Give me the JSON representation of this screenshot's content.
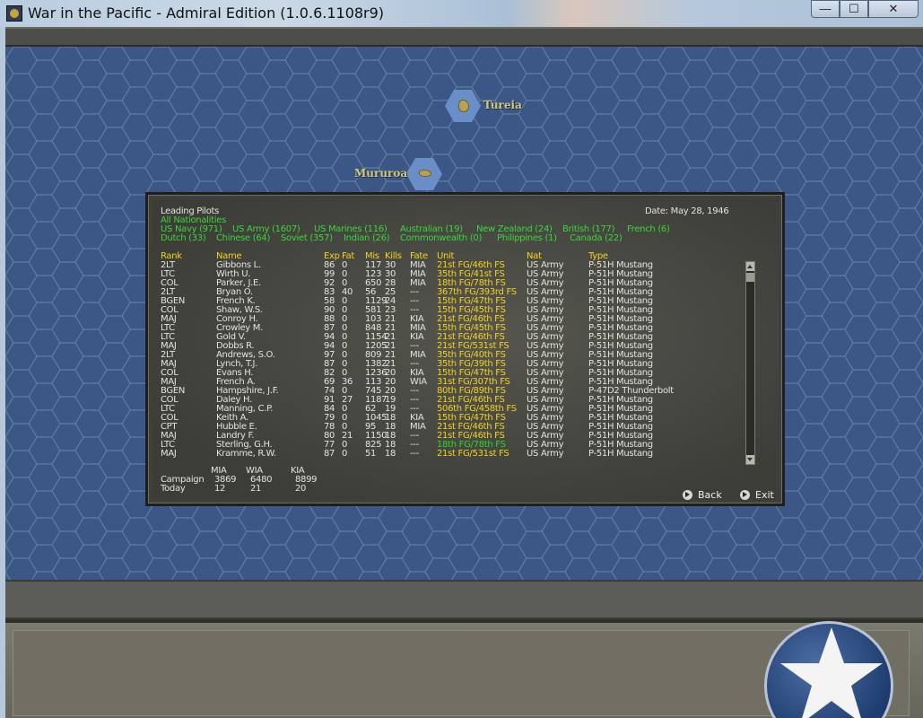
{
  "window": {
    "title": "War in the Pacific - Admiral Edition (1.0.6.1108r9)",
    "minimize_glyph": "—",
    "maximize_glyph": "☐",
    "close_glyph": "✕"
  },
  "map": {
    "places": [
      {
        "name": "Tureia"
      },
      {
        "name": "Mururoa"
      }
    ]
  },
  "dialog": {
    "title": "Leading Pilots",
    "date": "Date: May 28, 1946",
    "all_nationalities": "All Nationalities",
    "filters_row1": [
      "US Navy (971)",
      "US Army (1607)",
      "US Marines (116)",
      "Australian (19)",
      "New Zealand (24)",
      "British (177)",
      "French (6)"
    ],
    "filters_row2": [
      "Dutch (33)",
      "Chinese (64)",
      "Soviet (357)",
      "Indian (26)",
      "Commonwealth (0)",
      "Philippines (1)",
      "Canada (22)"
    ],
    "columns": {
      "rank": "Rank",
      "name": "Name",
      "exp": "Exp",
      "fat": "Fat",
      "mis": "Mis",
      "kills": "Kills",
      "fate": "Fate",
      "unit": "Unit",
      "nat": "Nat",
      "type": "Type"
    },
    "pilots": [
      {
        "rank": "2LT",
        "name": "Gibbons L.",
        "exp": "86",
        "fat": "0",
        "mis": "117",
        "kills": "30",
        "fate": "MIA",
        "unit": "21st FG/46th FS",
        "nat": "US Army",
        "type": "P-51H Mustang"
      },
      {
        "rank": "LTC",
        "name": "Wirth U.",
        "exp": "99",
        "fat": "0",
        "mis": "123",
        "kills": "30",
        "fate": "MIA",
        "unit": "35th FG/41st FS",
        "nat": "US Army",
        "type": "P-51H Mustang"
      },
      {
        "rank": "COL",
        "name": "Parker, J.E.",
        "exp": "92",
        "fat": "0",
        "mis": "650",
        "kills": "28",
        "fate": "MIA",
        "unit": "18th FG/78th FS",
        "nat": "US Army",
        "type": "P-51H Mustang"
      },
      {
        "rank": "2LT",
        "name": "Bryan O.",
        "exp": "83",
        "fat": "40",
        "mis": "56",
        "kills": "25",
        "fate": "---",
        "unit": "367th FG/393rd FS",
        "nat": "US Army",
        "type": "P-51H Mustang"
      },
      {
        "rank": "BGEN",
        "name": "French K.",
        "exp": "58",
        "fat": "0",
        "mis": "1129",
        "kills": "24",
        "fate": "---",
        "unit": "15th FG/47th FS",
        "nat": "US Army",
        "type": "P-51H Mustang"
      },
      {
        "rank": "COL",
        "name": "Shaw, W.S.",
        "exp": "90",
        "fat": "0",
        "mis": "581",
        "kills": "23",
        "fate": "---",
        "unit": "15th FG/45th FS",
        "nat": "US Army",
        "type": "P-51H Mustang"
      },
      {
        "rank": "MAJ",
        "name": "Conroy H.",
        "exp": "88",
        "fat": "0",
        "mis": "103",
        "kills": "21",
        "fate": "KIA",
        "unit": "21st FG/46th FS",
        "nat": "US Army",
        "type": "P-51H Mustang"
      },
      {
        "rank": "LTC",
        "name": "Crowley M.",
        "exp": "87",
        "fat": "0",
        "mis": "848",
        "kills": "21",
        "fate": "MIA",
        "unit": "15th FG/45th FS",
        "nat": "US Army",
        "type": "P-51H Mustang"
      },
      {
        "rank": "LTC",
        "name": "Gold V.",
        "exp": "94",
        "fat": "0",
        "mis": "1154",
        "kills": "21",
        "fate": "KIA",
        "unit": "21st FG/46th FS",
        "nat": "US Army",
        "type": "P-51H Mustang"
      },
      {
        "rank": "MAJ",
        "name": "Dobbs R.",
        "exp": "94",
        "fat": "0",
        "mis": "1205",
        "kills": "21",
        "fate": "---",
        "unit": "21st FG/531st FS",
        "nat": "US Army",
        "type": "P-51H Mustang"
      },
      {
        "rank": "2LT",
        "name": "Andrews, S.O.",
        "exp": "97",
        "fat": "0",
        "mis": "809",
        "kills": "21",
        "fate": "MIA",
        "unit": "35th FG/40th FS",
        "nat": "US Army",
        "type": "P-51H Mustang"
      },
      {
        "rank": "MAJ",
        "name": "Lynch, T.J.",
        "exp": "87",
        "fat": "0",
        "mis": "1382",
        "kills": "21",
        "fate": "---",
        "unit": "35th FG/39th FS",
        "nat": "US Army",
        "type": "P-51H Mustang"
      },
      {
        "rank": "COL",
        "name": "Evans H.",
        "exp": "82",
        "fat": "0",
        "mis": "1236",
        "kills": "20",
        "fate": "KIA",
        "unit": "15th FG/47th FS",
        "nat": "US Army",
        "type": "P-51H Mustang"
      },
      {
        "rank": "MAJ",
        "name": "French A.",
        "exp": "69",
        "fat": "36",
        "mis": "113",
        "kills": "20",
        "fate": "WIA",
        "unit": "31st FG/307th FS",
        "nat": "US Army",
        "type": "P-51H Mustang"
      },
      {
        "rank": "BGEN",
        "name": "Hampshire, J.F.",
        "exp": "74",
        "fat": "0",
        "mis": "745",
        "kills": "20",
        "fate": "---",
        "unit": "80th FG/89th FS",
        "nat": "US Army",
        "type": "P-47D2 Thunderbolt"
      },
      {
        "rank": "COL",
        "name": "Daley H.",
        "exp": "91",
        "fat": "27",
        "mis": "1187",
        "kills": "19",
        "fate": "---",
        "unit": "21st FG/46th FS",
        "nat": "US Army",
        "type": "P-51H Mustang"
      },
      {
        "rank": "LTC",
        "name": "Manning, C.P.",
        "exp": "84",
        "fat": "0",
        "mis": "62",
        "kills": "19",
        "fate": "---",
        "unit": "506th FG/458th FS",
        "nat": "US Army",
        "type": "P-51H Mustang"
      },
      {
        "rank": "COL",
        "name": "Keith A.",
        "exp": "79",
        "fat": "0",
        "mis": "1045",
        "kills": "18",
        "fate": "KIA",
        "unit": "15th FG/47th FS",
        "nat": "US Army",
        "type": "P-51H Mustang"
      },
      {
        "rank": "CPT",
        "name": "Hubble E.",
        "exp": "78",
        "fat": "0",
        "mis": "95",
        "kills": "18",
        "fate": "MIA",
        "unit": "21st FG/46th FS",
        "nat": "US Army",
        "type": "P-51H Mustang"
      },
      {
        "rank": "MAJ",
        "name": "Landry F.",
        "exp": "80",
        "fat": "21",
        "mis": "1150",
        "kills": "18",
        "fate": "---",
        "unit": "21st FG/46th FS",
        "nat": "US Army",
        "type": "P-51H Mustang"
      },
      {
        "rank": "LTC",
        "name": "Sterling, G.H.",
        "exp": "77",
        "fat": "0",
        "mis": "825",
        "kills": "18",
        "fate": "---",
        "unit": "18th FG/78th FS",
        "nat": "US Army",
        "type": "P-51H Mustang"
      },
      {
        "rank": "MAJ",
        "name": "Kramme, R.W.",
        "exp": "87",
        "fat": "0",
        "mis": "51",
        "kills": "18",
        "fate": "---",
        "unit": "21st FG/531st FS",
        "nat": "US Army",
        "type": "P-51H Mustang"
      }
    ],
    "summary": {
      "headers": [
        "MIA",
        "WIA",
        "KIA"
      ],
      "campaign_label": "Campaign",
      "campaign": [
        "3869",
        "6480",
        "8899"
      ],
      "today_label": "Today",
      "today": [
        "12",
        "21",
        "20"
      ]
    },
    "back_label": "Back",
    "exit_label": "Exit"
  },
  "colors": {
    "map_sea": "#3a5786",
    "filter_green": "#38d638",
    "header_yellow": "#f4d21b"
  }
}
